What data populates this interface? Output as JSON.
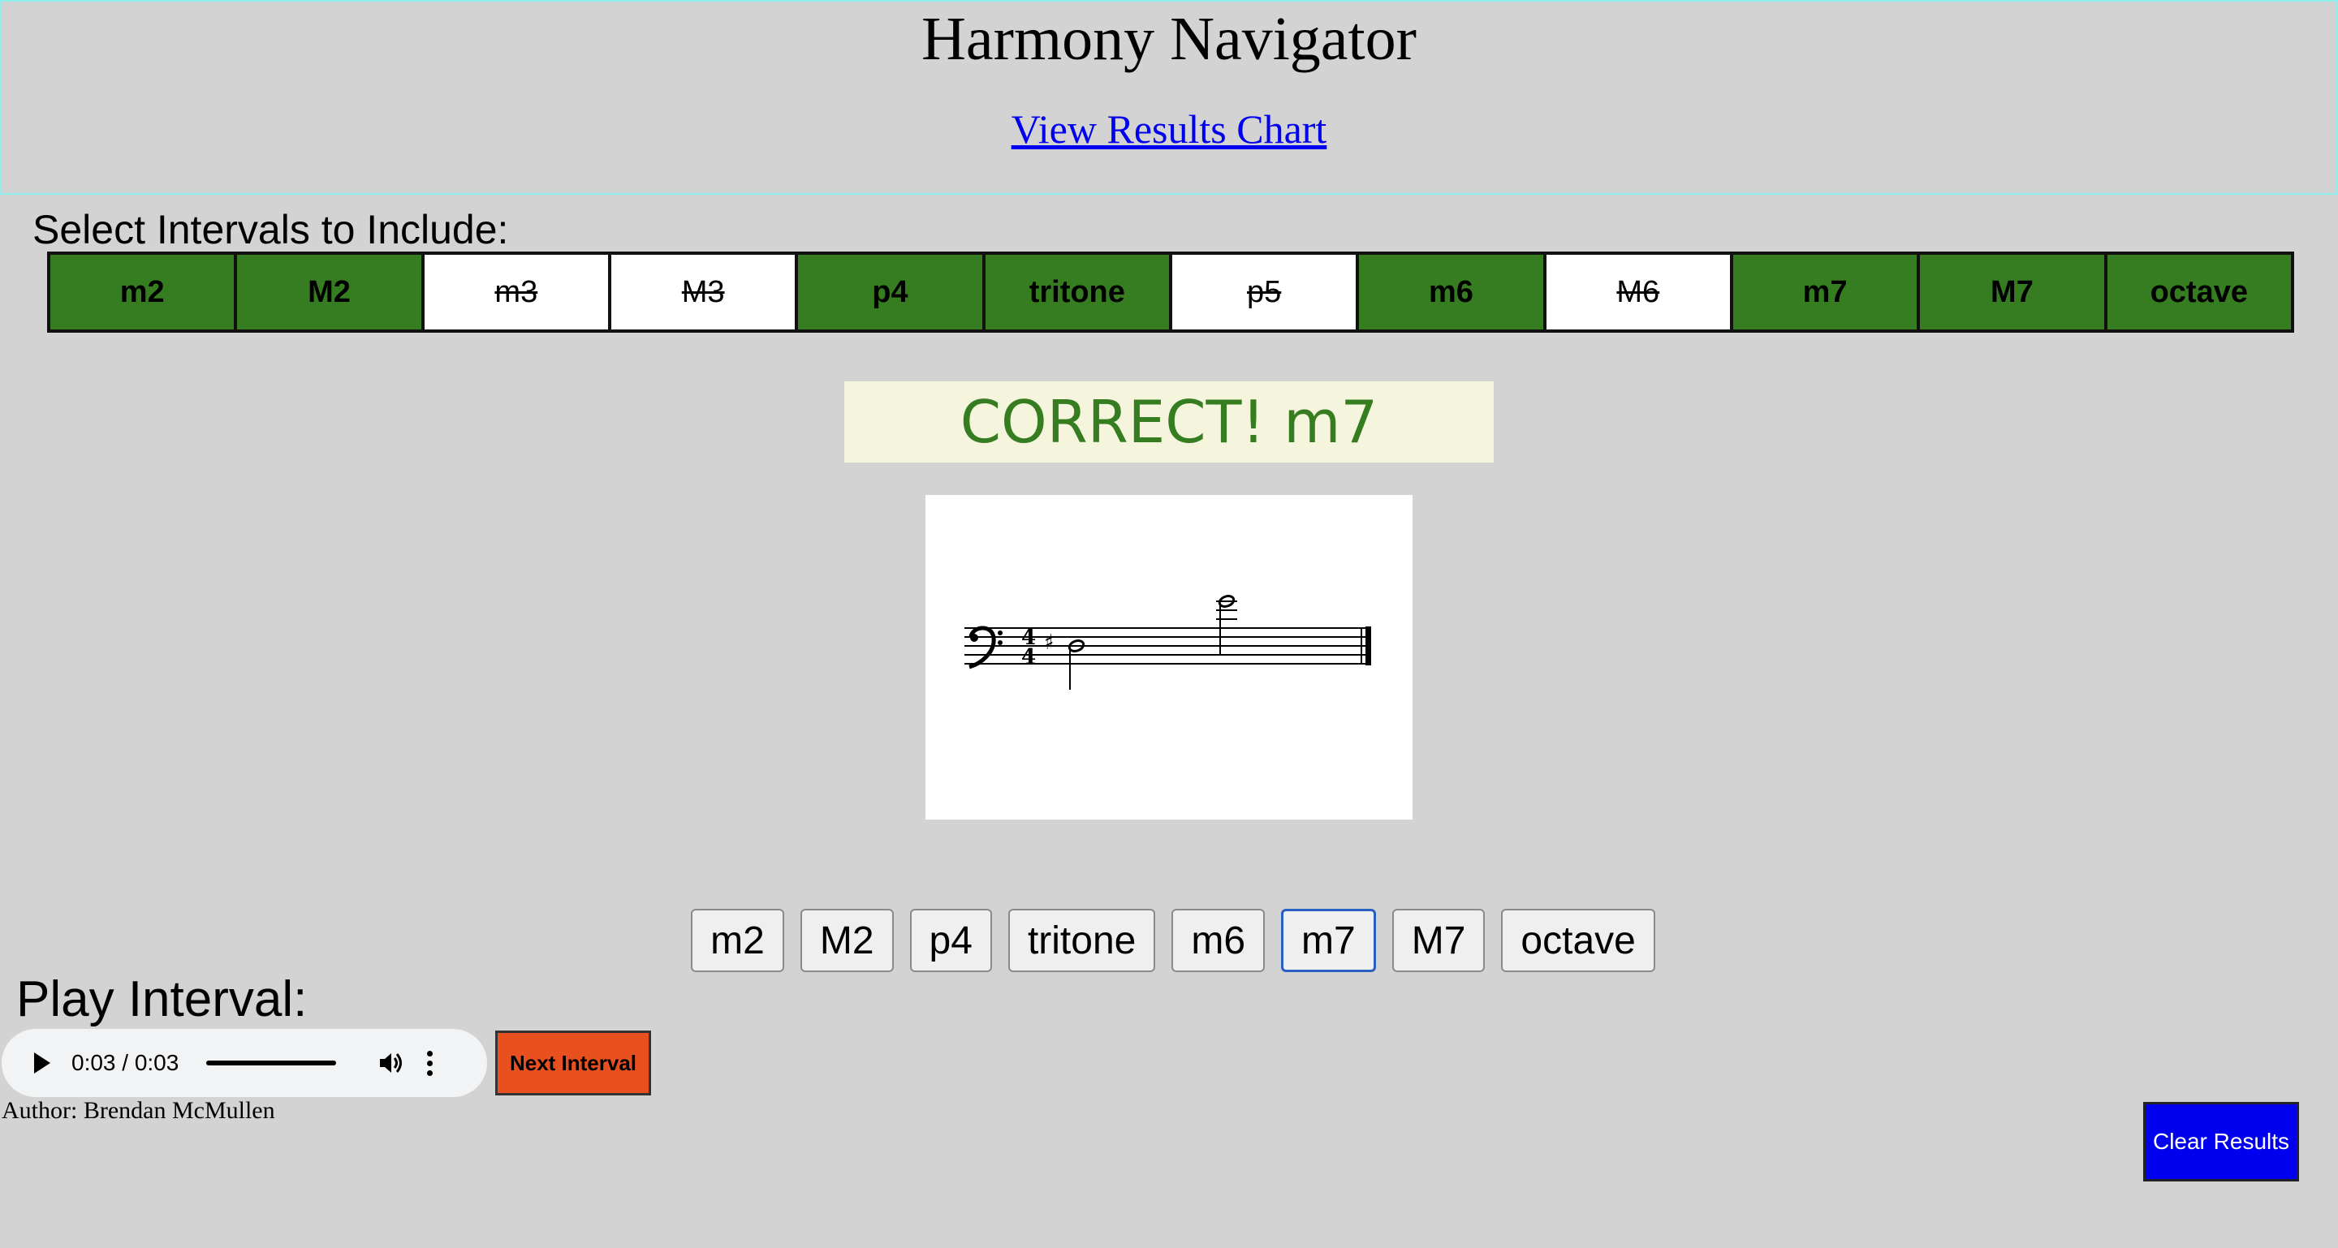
{
  "header": {
    "title": "Harmony Navigator",
    "results_link": "View Results Chart"
  },
  "interval_selector": {
    "label": "Select Intervals to Include:",
    "items": [
      {
        "label": "m2",
        "enabled": true
      },
      {
        "label": "M2",
        "enabled": true
      },
      {
        "label": "m3",
        "enabled": false
      },
      {
        "label": "M3",
        "enabled": false
      },
      {
        "label": "p4",
        "enabled": true
      },
      {
        "label": "tritone",
        "enabled": true
      },
      {
        "label": "p5",
        "enabled": false
      },
      {
        "label": "m6",
        "enabled": true
      },
      {
        "label": "M6",
        "enabled": false
      },
      {
        "label": "m7",
        "enabled": true
      },
      {
        "label": "M7",
        "enabled": true
      },
      {
        "label": "octave",
        "enabled": true
      }
    ],
    "colors": {
      "enabled": "#367c20",
      "disabled": "#ffffff"
    }
  },
  "feedback": {
    "text": "CORRECT! m7",
    "color": "#367c20"
  },
  "staff": {
    "clef": "bass",
    "time_signature": "4/4",
    "notes": [
      "F#",
      "E"
    ]
  },
  "answers": {
    "buttons": [
      "m2",
      "M2",
      "p4",
      "tritone",
      "m6",
      "m7",
      "M7",
      "octave"
    ],
    "selected": "m7"
  },
  "player": {
    "label": "Play Interval:",
    "time": "0:03 / 0:03",
    "progress": 1.0,
    "next_label": "Next Interval"
  },
  "footer": {
    "author": "Author: Brendan McMullen",
    "clear_label": "Clear Results"
  }
}
